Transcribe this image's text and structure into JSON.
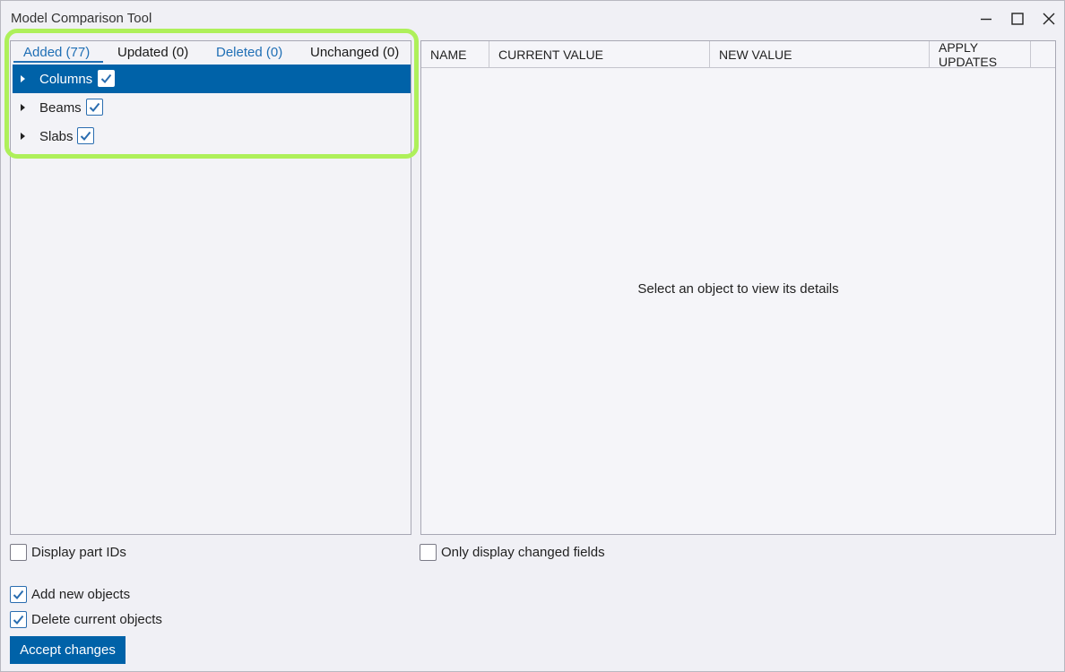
{
  "window": {
    "title": "Model Comparison Tool",
    "controls": [
      "minimize-icon",
      "maximize-icon",
      "close-icon"
    ]
  },
  "tabs": [
    {
      "label": "Added (77)",
      "active": true,
      "color": "#1f6fb5"
    },
    {
      "label": "Updated (0)",
      "active": false
    },
    {
      "label": "Deleted (0)",
      "active": false,
      "color": "#1f6fb5"
    },
    {
      "label": "Unchanged (0)",
      "active": false
    }
  ],
  "tree": [
    {
      "label": "Columns",
      "checked": true,
      "selected": true
    },
    {
      "label": "Beams",
      "checked": true,
      "selected": false
    },
    {
      "label": "Slabs",
      "checked": true,
      "selected": false
    }
  ],
  "grid": {
    "columns": [
      "NAME",
      "CURRENT VALUE",
      "NEW VALUE",
      "APPLY UPDATES"
    ],
    "empty_message": "Select an object to view its details"
  },
  "options": {
    "display_part_ids": {
      "label": "Display part IDs",
      "checked": false
    },
    "only_changed_fields": {
      "label": "Only display changed fields",
      "checked": false
    },
    "add_new_objects": {
      "label": "Add new objects",
      "checked": true
    },
    "delete_current_objects": {
      "label": "Delete current objects",
      "checked": true
    }
  },
  "accept_button": {
    "label": "Accept changes"
  },
  "colors": {
    "accent": "#0062a8",
    "highlight": "#aef05a",
    "link_blue": "#1f6fb5"
  }
}
